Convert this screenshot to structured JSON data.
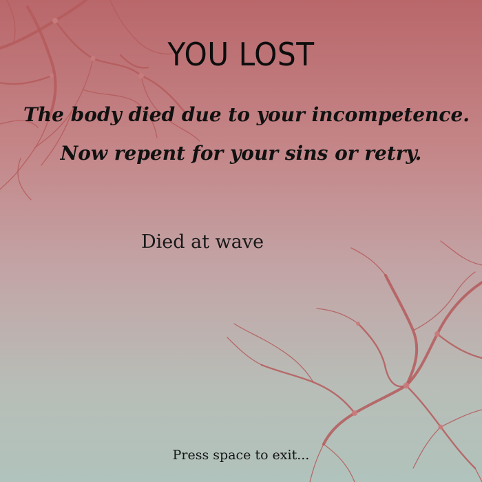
{
  "screen": {
    "title": "YOU LOST",
    "message_line1": "The body died due to your incompetence.",
    "message_line2": "Now repent for your sins or retry.",
    "wave_label": "Died at wave",
    "exit_prompt": "Press space to exit..."
  },
  "colors": {
    "background_top": "#b9676a",
    "background_bottom": "#b0c3bc",
    "vein": "#b55a5c",
    "text": "#0d0d0d"
  }
}
